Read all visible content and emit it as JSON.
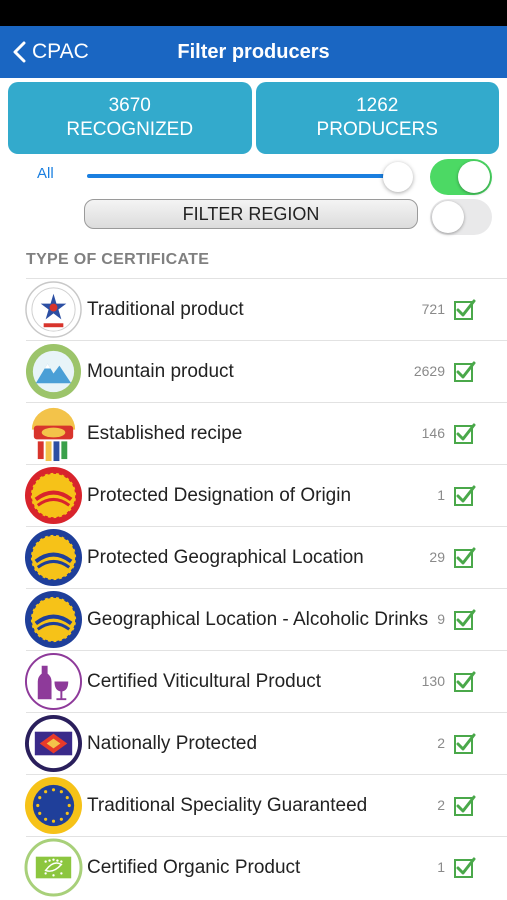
{
  "nav": {
    "back_label": "CPAC",
    "title": "Filter producers"
  },
  "stats": [
    {
      "number": "3670",
      "label": "RECOGNIZED"
    },
    {
      "number": "1262",
      "label": "PRODUCERS"
    }
  ],
  "filters": {
    "all_label": "All",
    "all_toggle_on": true,
    "region_button": "FILTER REGION",
    "region_toggle_on": false
  },
  "section_title": "TYPE OF CERTIFICATE",
  "certificates": [
    {
      "label": "Traditional product",
      "count": "721",
      "checked": true,
      "icon": "traditional-product-icon"
    },
    {
      "label": "Mountain product",
      "count": "2629",
      "checked": true,
      "icon": "mountain-product-icon"
    },
    {
      "label": "Established recipe",
      "count": "146",
      "checked": true,
      "icon": "established-recipe-icon"
    },
    {
      "label": "Protected Designation of Origin",
      "count": "1",
      "checked": true,
      "icon": "pdo-icon"
    },
    {
      "label": "Protected Geographical Location",
      "count": "29",
      "checked": true,
      "icon": "pgi-icon"
    },
    {
      "label": "Geographical Location - Alcoholic Drinks",
      "count": "9",
      "checked": true,
      "icon": "gi-alcoholic-icon"
    },
    {
      "label": "Certified Viticultural Product",
      "count": "130",
      "checked": true,
      "icon": "wine-bottle-glass-icon"
    },
    {
      "label": "Nationally Protected",
      "count": "2",
      "checked": true,
      "icon": "nationally-protected-icon"
    },
    {
      "label": "Traditional Speciality Guaranteed",
      "count": "2",
      "checked": true,
      "icon": "tsg-icon"
    },
    {
      "label": "Certified Organic Product",
      "count": "1",
      "checked": true,
      "icon": "eu-organic-leaf-icon"
    }
  ],
  "colors": {
    "nav": "#1a66c2",
    "stat_bg": "#33aacc",
    "accent": "#1a7fe0",
    "toggle_on": "#4cd964",
    "check": "#4aa84a"
  }
}
